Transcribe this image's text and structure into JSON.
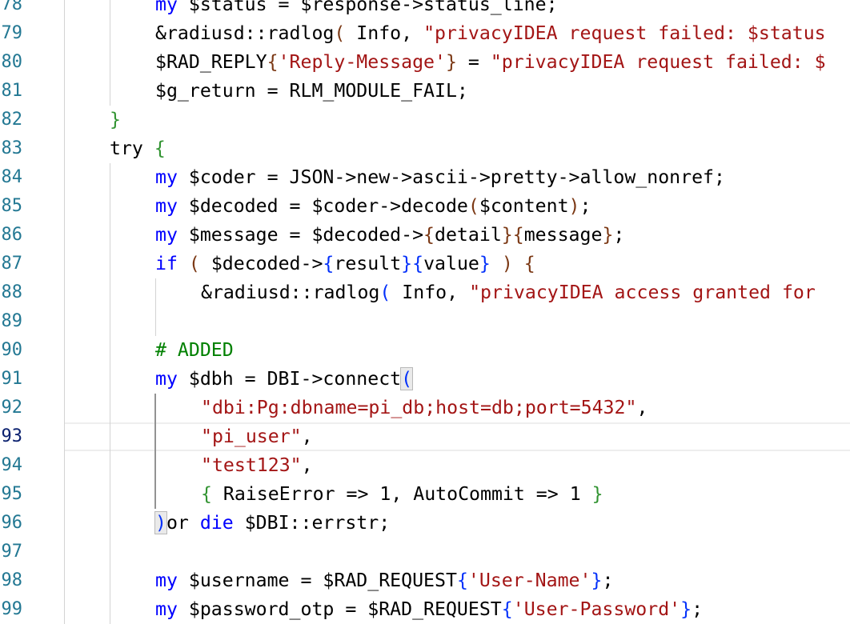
{
  "editor": {
    "line_numbers": [
      "78",
      "79",
      "80",
      "81",
      "82",
      "83",
      "84",
      "85",
      "86",
      "87",
      "88",
      "89",
      "90",
      "91",
      "92",
      "93",
      "94",
      "95",
      "96",
      "97",
      "98",
      "99"
    ],
    "active_line": "93",
    "lines": [
      {
        "num": "78",
        "indent": 2,
        "tokens": [
          {
            "t": "my",
            "c": "kw"
          },
          {
            "t": " $status = $response->status_line;"
          }
        ]
      },
      {
        "num": "79",
        "indent": 2,
        "tokens": [
          {
            "t": "&radiusd::radlog"
          },
          {
            "t": "(",
            "c": "b2"
          },
          {
            "t": " Info, "
          },
          {
            "t": "\"privacyIDEA request failed: $status",
            "c": "str"
          }
        ]
      },
      {
        "num": "80",
        "indent": 2,
        "tokens": [
          {
            "t": "$RAD_REPLY"
          },
          {
            "t": "{",
            "c": "b2"
          },
          {
            "t": "'Reply-Message'",
            "c": "str"
          },
          {
            "t": "}",
            "c": "b2"
          },
          {
            "t": " = "
          },
          {
            "t": "\"privacyIDEA request failed: $",
            "c": "str"
          }
        ]
      },
      {
        "num": "81",
        "indent": 2,
        "tokens": [
          {
            "t": "$g_return = RLM_MODULE_FAIL;"
          }
        ]
      },
      {
        "num": "82",
        "indent": 1,
        "tokens": [
          {
            "t": "}",
            "c": "b1"
          }
        ]
      },
      {
        "num": "83",
        "indent": 1,
        "tokens": [
          {
            "t": "try "
          },
          {
            "t": "{",
            "c": "b1"
          }
        ]
      },
      {
        "num": "84",
        "indent": 2,
        "tokens": [
          {
            "t": "my",
            "c": "kw"
          },
          {
            "t": " $coder = JSON->new->ascii->pretty->allow_nonref;"
          }
        ]
      },
      {
        "num": "85",
        "indent": 2,
        "tokens": [
          {
            "t": "my",
            "c": "kw"
          },
          {
            "t": " $decoded = $coder->decode"
          },
          {
            "t": "(",
            "c": "b2"
          },
          {
            "t": "$content"
          },
          {
            "t": ")",
            "c": "b2"
          },
          {
            "t": ";"
          }
        ]
      },
      {
        "num": "86",
        "indent": 2,
        "tokens": [
          {
            "t": "my",
            "c": "kw"
          },
          {
            "t": " $message = $decoded->"
          },
          {
            "t": "{",
            "c": "b2"
          },
          {
            "t": "detail"
          },
          {
            "t": "}{",
            "c": "b2"
          },
          {
            "t": "message"
          },
          {
            "t": "}",
            "c": "b2"
          },
          {
            "t": ";"
          }
        ]
      },
      {
        "num": "87",
        "indent": 2,
        "tokens": [
          {
            "t": "if",
            "c": "kw"
          },
          {
            "t": " "
          },
          {
            "t": "(",
            "c": "b2"
          },
          {
            "t": " $decoded->"
          },
          {
            "t": "{",
            "c": "b3"
          },
          {
            "t": "result"
          },
          {
            "t": "}{",
            "c": "b3"
          },
          {
            "t": "value"
          },
          {
            "t": "}",
            "c": "b3"
          },
          {
            "t": " "
          },
          {
            "t": ")",
            "c": "b2"
          },
          {
            "t": " "
          },
          {
            "t": "{",
            "c": "b2"
          }
        ]
      },
      {
        "num": "88",
        "indent": 3,
        "tokens": [
          {
            "t": "&radiusd::radlog"
          },
          {
            "t": "(",
            "c": "b3"
          },
          {
            "t": " Info, "
          },
          {
            "t": "\"privacyIDEA access granted for",
            "c": "str"
          }
        ]
      },
      {
        "num": "89",
        "indent": 0,
        "tokens": []
      },
      {
        "num": "90",
        "indent": 2,
        "tokens": [
          {
            "t": "# ADDED",
            "c": "com"
          }
        ]
      },
      {
        "num": "91",
        "indent": 2,
        "tokens": [
          {
            "t": "my",
            "c": "kw"
          },
          {
            "t": " $dbh = DBI->connect"
          },
          {
            "t": "(",
            "c": "b3 bm"
          }
        ]
      },
      {
        "num": "92",
        "indent": 3,
        "tokens": [
          {
            "t": "\"dbi:Pg:dbname=pi_db;host=db;port=5432\"",
            "c": "str"
          },
          {
            "t": ","
          }
        ]
      },
      {
        "num": "93",
        "indent": 3,
        "tokens": [
          {
            "t": "\"pi_user\"",
            "c": "str"
          },
          {
            "t": ","
          }
        ]
      },
      {
        "num": "94",
        "indent": 3,
        "tokens": [
          {
            "t": "\"test123\"",
            "c": "str"
          },
          {
            "t": ","
          }
        ]
      },
      {
        "num": "95",
        "indent": 3,
        "tokens": [
          {
            "t": "{",
            "c": "b1"
          },
          {
            "t": " RaiseError => 1, AutoCommit => 1 "
          },
          {
            "t": "}",
            "c": "b1"
          }
        ]
      },
      {
        "num": "96",
        "indent": 2,
        "tokens": [
          {
            "t": ")",
            "c": "b3 bm"
          },
          {
            "t": "or "
          },
          {
            "t": "die",
            "c": "kw"
          },
          {
            "t": " $DBI::errstr;"
          }
        ]
      },
      {
        "num": "97",
        "indent": 0,
        "tokens": []
      },
      {
        "num": "98",
        "indent": 2,
        "tokens": [
          {
            "t": "my",
            "c": "kw"
          },
          {
            "t": " $username = $RAD_REQUEST"
          },
          {
            "t": "{",
            "c": "b3"
          },
          {
            "t": "'User-Name'",
            "c": "str"
          },
          {
            "t": "}",
            "c": "b3"
          },
          {
            "t": ";"
          }
        ]
      },
      {
        "num": "99",
        "indent": 2,
        "tokens": [
          {
            "t": "my",
            "c": "kw"
          },
          {
            "t": " $password_otp = $RAD_REQUEST"
          },
          {
            "t": "{",
            "c": "b3"
          },
          {
            "t": "'User-Password'",
            "c": "str"
          },
          {
            "t": "}",
            "c": "b3"
          },
          {
            "t": ";"
          }
        ]
      }
    ]
  }
}
